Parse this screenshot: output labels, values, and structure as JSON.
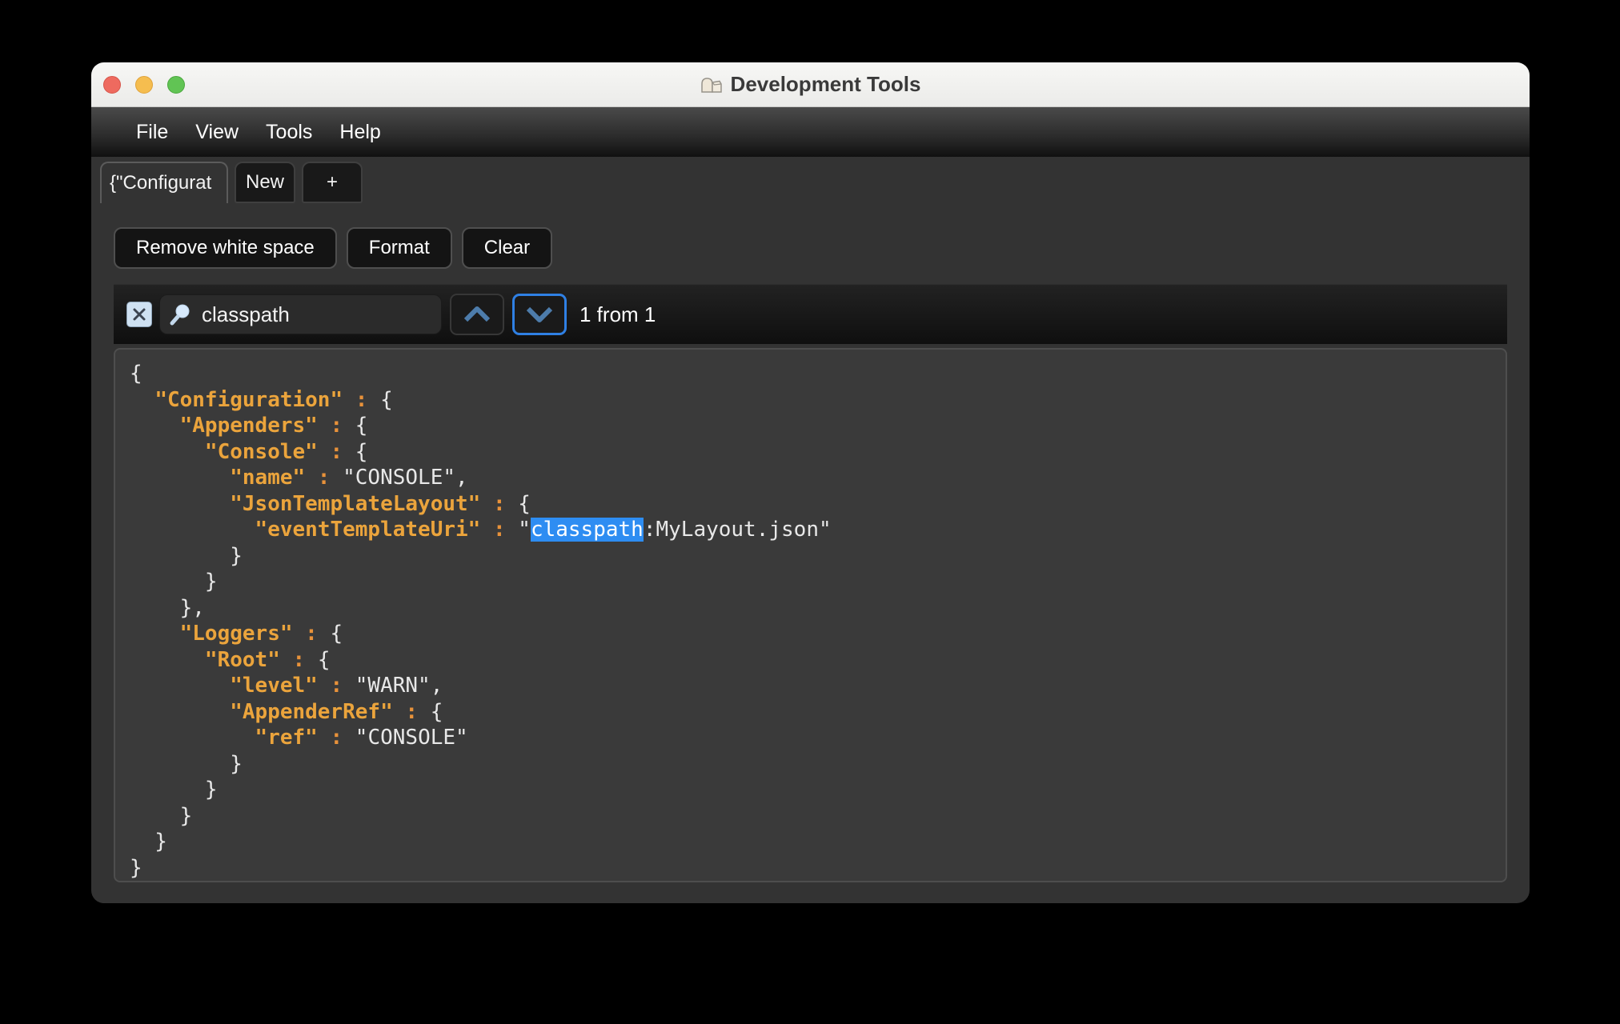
{
  "window": {
    "title": "Development Tools"
  },
  "menu": {
    "items": [
      {
        "label": "File"
      },
      {
        "label": "View"
      },
      {
        "label": "Tools"
      },
      {
        "label": "Help"
      }
    ]
  },
  "tabs": {
    "items": [
      {
        "label": "{\"Configurat",
        "name": "tab-configuration",
        "active": true
      },
      {
        "label": "New",
        "name": "tab-new",
        "active": false
      },
      {
        "label": "+",
        "name": "tab-add",
        "active": false
      }
    ]
  },
  "toolbar": {
    "buttons": [
      {
        "label": "Remove white space",
        "name": "remove-white-space-button"
      },
      {
        "label": "Format",
        "name": "format-button"
      },
      {
        "label": "Clear",
        "name": "clear-button"
      }
    ]
  },
  "search": {
    "value": "classpath",
    "result_text": "1 from 1"
  },
  "colors": {
    "key_orange": "#eba43c",
    "colon_orange": "#e8923a",
    "plain_text": "#e8e8e8",
    "match_highlight": "#2e8df2",
    "focus_ring": "#2f80e4",
    "chevron_blue": "#4d7cab"
  },
  "editor": {
    "lines": [
      [
        [
          "p",
          "{"
        ]
      ],
      [
        [
          "p",
          "  "
        ],
        [
          "k",
          "\"Configuration\""
        ],
        [
          "c",
          " : "
        ],
        [
          "p",
          "{"
        ]
      ],
      [
        [
          "p",
          "    "
        ],
        [
          "k",
          "\"Appenders\""
        ],
        [
          "c",
          " : "
        ],
        [
          "p",
          "{"
        ]
      ],
      [
        [
          "p",
          "      "
        ],
        [
          "k",
          "\"Console\""
        ],
        [
          "c",
          " : "
        ],
        [
          "p",
          "{"
        ]
      ],
      [
        [
          "p",
          "        "
        ],
        [
          "k",
          "\"name\""
        ],
        [
          "c",
          " : "
        ],
        [
          "p",
          "\"CONSOLE\","
        ]
      ],
      [
        [
          "p",
          "        "
        ],
        [
          "k",
          "\"JsonTemplateLayout\""
        ],
        [
          "c",
          " : "
        ],
        [
          "p",
          "{"
        ]
      ],
      [
        [
          "p",
          "          "
        ],
        [
          "k",
          "\"eventTemplateUri\""
        ],
        [
          "c",
          " : "
        ],
        [
          "p",
          "\""
        ],
        [
          "h",
          "classpath"
        ],
        [
          "p",
          ":MyLayout.json\""
        ]
      ],
      [
        [
          "p",
          "        }"
        ]
      ],
      [
        [
          "p",
          "      }"
        ]
      ],
      [
        [
          "p",
          "    },"
        ]
      ],
      [
        [
          "p",
          "    "
        ],
        [
          "k",
          "\"Loggers\""
        ],
        [
          "c",
          " : "
        ],
        [
          "p",
          "{"
        ]
      ],
      [
        [
          "p",
          "      "
        ],
        [
          "k",
          "\"Root\""
        ],
        [
          "c",
          " : "
        ],
        [
          "p",
          "{"
        ]
      ],
      [
        [
          "p",
          "        "
        ],
        [
          "k",
          "\"level\""
        ],
        [
          "c",
          " : "
        ],
        [
          "p",
          "\"WARN\","
        ]
      ],
      [
        [
          "p",
          "        "
        ],
        [
          "k",
          "\"AppenderRef\""
        ],
        [
          "c",
          " : "
        ],
        [
          "p",
          "{"
        ]
      ],
      [
        [
          "p",
          "          "
        ],
        [
          "k",
          "\"ref\""
        ],
        [
          "c",
          " : "
        ],
        [
          "p",
          "\"CONSOLE\""
        ]
      ],
      [
        [
          "p",
          "        }"
        ]
      ],
      [
        [
          "p",
          "      }"
        ]
      ],
      [
        [
          "p",
          "    }"
        ]
      ],
      [
        [
          "p",
          "  }"
        ]
      ],
      [
        [
          "p",
          "}"
        ]
      ]
    ]
  }
}
